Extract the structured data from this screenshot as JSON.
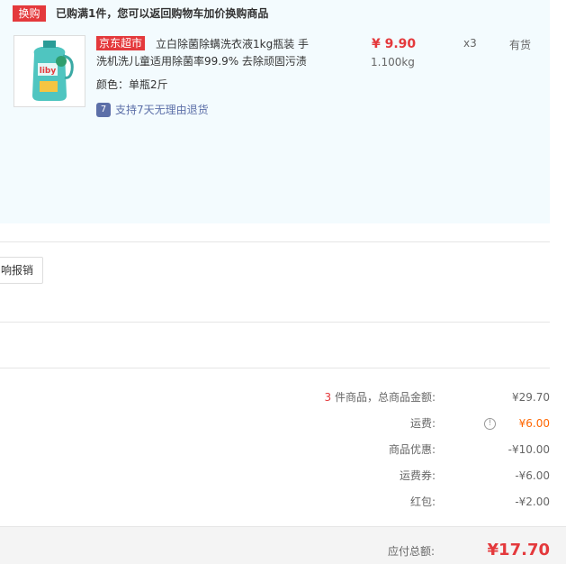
{
  "huangou": {
    "badge": "换购",
    "tip": "已购满1件，您可以返回购物车加价换购商品"
  },
  "product": {
    "image_alt": "liby laundry detergent bottle",
    "tag": "京东超市",
    "name": "立白除菌除螨洗衣液1kg瓶装 手洗机洗儿童适用除菌率99.9% 去除顽固污渍",
    "attr": "颜色：单瓶2斤",
    "return_policy": "支持7天无理由退货",
    "price": "¥ 9.90",
    "weight": "1.100kg",
    "quantity": "x3",
    "stock": "有货"
  },
  "invoice": {
    "button_label": "响报销"
  },
  "summary": {
    "count": "3",
    "count_suffix": "件商品，总商品金额:",
    "goods_total": "¥29.70",
    "freight_label": "运费:",
    "freight_value": "¥6.00",
    "discount_label": "商品优惠:",
    "discount_value": "-¥10.00",
    "freight_coupon_label": "运费券:",
    "freight_coupon_value": "-¥6.00",
    "redpacket_label": "红包:",
    "redpacket_value": "-¥2.00"
  },
  "total": {
    "label": "应付总额:",
    "value": "¥17.70"
  },
  "colors": {
    "accent_red": "#e4393c",
    "freight_orange": "#ff6600",
    "light_blue_bg": "#f3fbfe",
    "return_blue": "#5c6fa8"
  }
}
